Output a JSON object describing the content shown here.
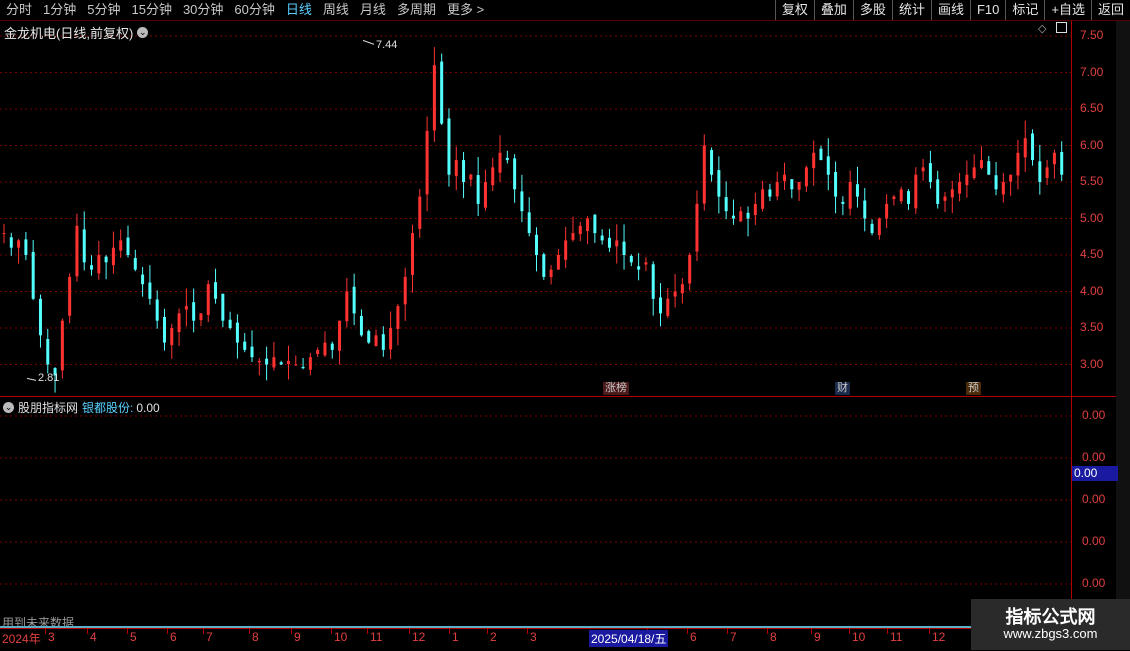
{
  "toolbar": {
    "periods": [
      "分时",
      "1分钟",
      "5分钟",
      "15分钟",
      "30分钟",
      "60分钟",
      "日线",
      "周线",
      "月线",
      "多周期",
      "更多 >"
    ],
    "active_period": "日线",
    "buttons": [
      "复权",
      "叠加",
      "多股",
      "统计",
      "画线",
      "F10",
      "标记",
      "+自选",
      "返回"
    ]
  },
  "stock": {
    "title": "金龙机电(日线,前复权)",
    "high_label": "7.44",
    "low_label": "2.81"
  },
  "price_axis": [
    "7.50",
    "7.00",
    "6.50",
    "6.00",
    "5.50",
    "5.00",
    "4.50",
    "4.00",
    "3.50",
    "3.00"
  ],
  "markers": [
    {
      "text": "涨榜",
      "color": "#ff9a9a"
    },
    {
      "text": "财",
      "color": "#7fb3ff"
    },
    {
      "text": "预",
      "color": "#ffbf6b"
    }
  ],
  "indicator": {
    "source": "股朋指标网",
    "name": "银都股份:",
    "value": "0.00",
    "axis": [
      "0.00",
      "0.00",
      "0.00",
      "0.00",
      "0.00"
    ],
    "cursor_value": "0.00"
  },
  "footer_note": "用到未来数据",
  "date_axis": {
    "year": "2024年",
    "months": [
      "3",
      "4",
      "5",
      "6",
      "7",
      "8",
      "9",
      "10",
      "11",
      "12",
      "1",
      "2",
      "3",
      "4",
      "5",
      "6",
      "7",
      "8",
      "9",
      "10",
      "11",
      "12",
      "1"
    ],
    "cursor_date": "2025/04/18/五"
  },
  "watermark": {
    "title": "指标公式网",
    "url": "www.zbgs3.com"
  },
  "chart_data": {
    "type": "candlestick",
    "title": "金龙机电(日线,前复权)",
    "ylim": [
      2.6,
      7.6
    ],
    "annotations": [
      {
        "label": "7.44",
        "value": 7.44
      },
      {
        "label": "2.81",
        "value": 2.81
      }
    ],
    "close_series": [
      4.8,
      4.6,
      4.7,
      4.5,
      3.9,
      3.4,
      3.0,
      2.85,
      3.6,
      4.2,
      4.9,
      4.4,
      4.3,
      4.5,
      4.4,
      4.6,
      4.7,
      4.5,
      4.3,
      4.1,
      3.9,
      3.6,
      3.3,
      3.5,
      3.7,
      3.8,
      3.6,
      3.7,
      4.1,
      3.9,
      3.6,
      3.5,
      3.3,
      3.2,
      3.1,
      3.05,
      3.0,
      3.1,
      3.0,
      3.05,
      3.0,
      2.95,
      3.1,
      3.2,
      3.3,
      3.2,
      3.6,
      4.0,
      3.7,
      3.4,
      3.3,
      3.4,
      3.2,
      3.5,
      3.8,
      4.2,
      4.8,
      5.3,
      6.2,
      7.1,
      6.3,
      5.6,
      5.8,
      5.5,
      5.6,
      5.2,
      5.5,
      5.7,
      5.9,
      5.8,
      5.4,
      5.1,
      4.8,
      4.5,
      4.2,
      4.3,
      4.5,
      4.7,
      4.8,
      4.9,
      5.0,
      4.8,
      4.7,
      4.6,
      4.7,
      4.5,
      4.4,
      4.3,
      4.4,
      3.9,
      3.7,
      3.9,
      4.0,
      4.1,
      4.5,
      5.2,
      6.0,
      5.6,
      5.3,
      5.1,
      5.0,
      5.1,
      5.0,
      5.2,
      5.4,
      5.3,
      5.5,
      5.6,
      5.4,
      5.5,
      5.7,
      5.9,
      5.8,
      5.6,
      5.3,
      5.2,
      5.5,
      5.3,
      5.0,
      4.8,
      5.0,
      5.2,
      5.3,
      5.4,
      5.2,
      5.6,
      5.7,
      5.5,
      5.2,
      5.3,
      5.4,
      5.5,
      5.6,
      5.7,
      5.8,
      5.6,
      5.4,
      5.5,
      5.6,
      5.9,
      6.1,
      5.8,
      5.5,
      5.7,
      5.9,
      5.6
    ]
  }
}
